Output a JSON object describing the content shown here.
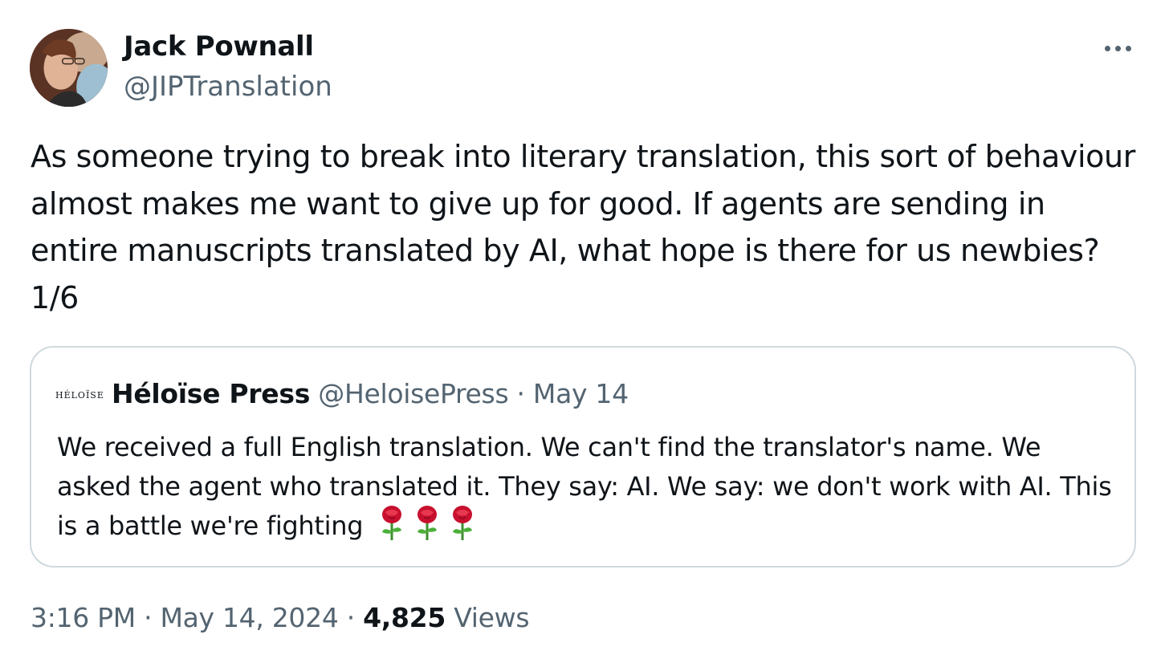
{
  "author": {
    "display_name": "Jack Pownall",
    "handle": "@JIPTranslation"
  },
  "tweet": {
    "text": "As someone trying to break into literary translation, this sort of behaviour almost makes me want to give up for good. If agents are sending in entire manuscripts translated by AI, what hope is there for us newbies? 1/6"
  },
  "quoted_tweet": {
    "logo_text": "HÉLOÏSE",
    "display_name": "Héloïse Press",
    "handle": "@HeloisePress",
    "separator": " · ",
    "date": "May 14",
    "text": "We received a full English translation. We can't find the translator's name. We asked the agent who translated it. They say: AI. We say: we don't work with AI. This is a battle we're fighting",
    "emoji": [
      "rose-icon",
      "rose-icon",
      "rose-icon"
    ]
  },
  "footer": {
    "time": "3:16 PM",
    "separator": " · ",
    "date": "May 14, 2024",
    "views_count": "4,825",
    "views_label": "Views"
  },
  "icons": {
    "more": "more-horizontal-icon"
  },
  "colors": {
    "text": "#0f1419",
    "secondary": "#536471",
    "border": "#cfd9de",
    "rose": "#c8102e"
  }
}
